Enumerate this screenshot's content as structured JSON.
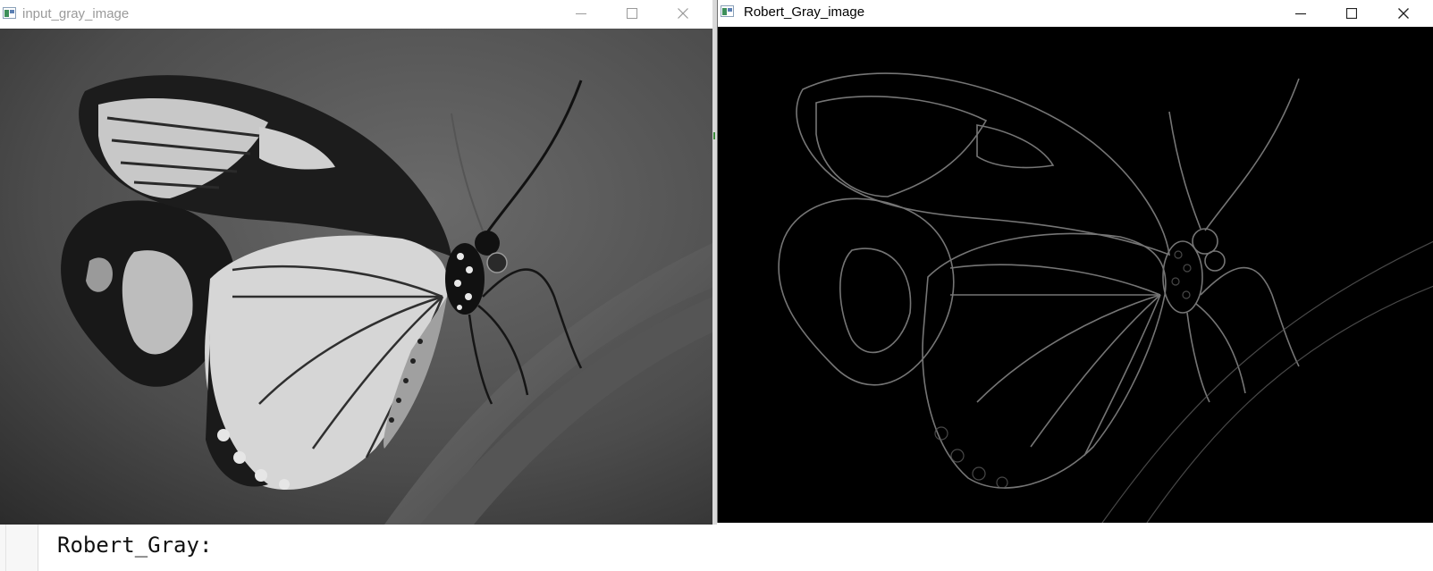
{
  "editor": {
    "code_line": "Robert_Gray:"
  },
  "windows": [
    {
      "id": "left",
      "title": "input_gray_image",
      "active": false,
      "image_kind": "grayscale photo of a butterfly perched on a leaf"
    },
    {
      "id": "right",
      "title": "Robert_Gray_image",
      "active": true,
      "image_kind": "Roberts edge-detection result on black background"
    }
  ],
  "controls": {
    "minimize": "minimize-icon",
    "maximize": "maximize-icon",
    "close": "close-icon"
  },
  "colors": {
    "inactive_title": "#9a9a9a",
    "active_title": "#000000",
    "edge_bg": "#000000"
  }
}
